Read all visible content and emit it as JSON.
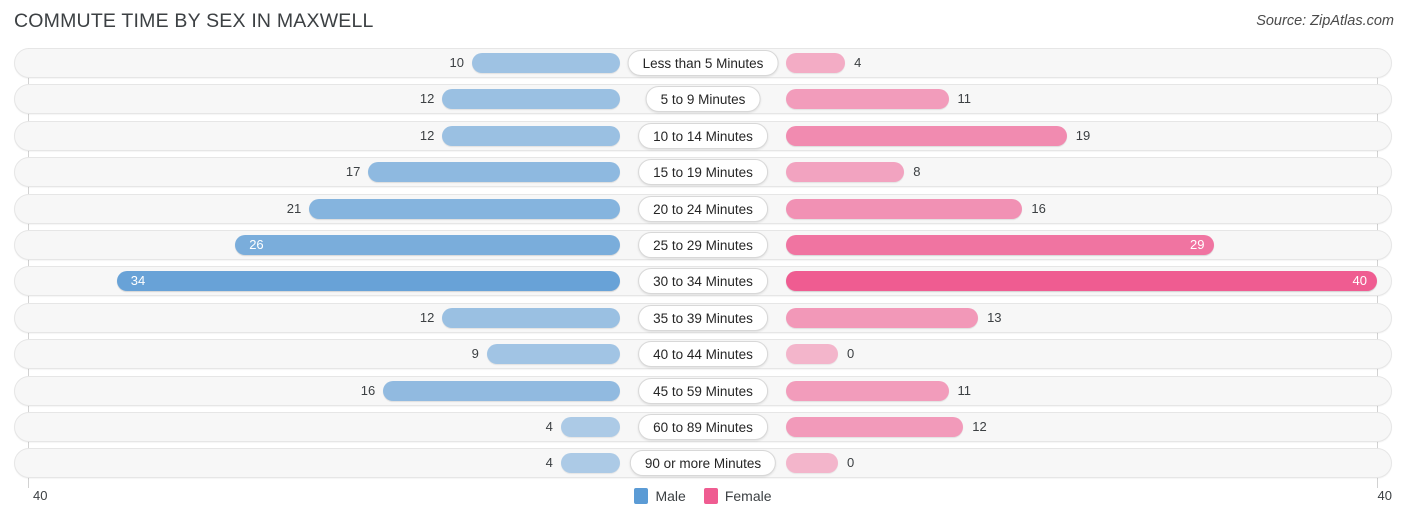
{
  "header": {
    "title": "COMMUTE TIME BY SEX IN MAXWELL",
    "source": "Source: ZipAtlas.com"
  },
  "legend": {
    "male_label": "Male",
    "female_label": "Female",
    "male_color": "#5B9BD5",
    "female_color": "#EF5C91"
  },
  "axis": {
    "left_tick": "40",
    "right_tick": "40",
    "max": 40
  },
  "chart_data": {
    "type": "bar",
    "title": "COMMUTE TIME BY SEX IN MAXWELL",
    "subtitle": "Source: ZipAtlas.com",
    "orientation": "horizontal-diverging",
    "xlabel": "",
    "ylabel": "",
    "xlim": [
      40,
      40
    ],
    "grid": false,
    "legend_position": "bottom-center",
    "categories": [
      "Less than 5 Minutes",
      "5 to 9 Minutes",
      "10 to 14 Minutes",
      "15 to 19 Minutes",
      "20 to 24 Minutes",
      "25 to 29 Minutes",
      "30 to 34 Minutes",
      "35 to 39 Minutes",
      "40 to 44 Minutes",
      "45 to 59 Minutes",
      "60 to 89 Minutes",
      "90 or more Minutes"
    ],
    "series": [
      {
        "name": "Male",
        "color": "#5B9BD5",
        "values": [
          10,
          12,
          12,
          17,
          21,
          26,
          34,
          12,
          9,
          16,
          4,
          4
        ]
      },
      {
        "name": "Female",
        "color": "#EF5C91",
        "values": [
          4,
          11,
          19,
          8,
          16,
          29,
          40,
          13,
          0,
          11,
          12,
          0
        ]
      }
    ]
  },
  "rows": [
    {
      "label": "Less than 5 Minutes",
      "male": 10,
      "female": 4,
      "male_text": "10",
      "female_text": "4"
    },
    {
      "label": "5 to 9 Minutes",
      "male": 12,
      "female": 11,
      "male_text": "12",
      "female_text": "11"
    },
    {
      "label": "10 to 14 Minutes",
      "male": 12,
      "female": 19,
      "male_text": "12",
      "female_text": "19"
    },
    {
      "label": "15 to 19 Minutes",
      "male": 17,
      "female": 8,
      "male_text": "17",
      "female_text": "8"
    },
    {
      "label": "20 to 24 Minutes",
      "male": 21,
      "female": 16,
      "male_text": "21",
      "female_text": "16"
    },
    {
      "label": "25 to 29 Minutes",
      "male": 26,
      "female": 29,
      "male_text": "26",
      "female_text": "29"
    },
    {
      "label": "30 to 34 Minutes",
      "male": 34,
      "female": 40,
      "male_text": "34",
      "female_text": "40"
    },
    {
      "label": "35 to 39 Minutes",
      "male": 12,
      "female": 13,
      "male_text": "12",
      "female_text": "13"
    },
    {
      "label": "40 to 44 Minutes",
      "male": 9,
      "female": 0,
      "male_text": "9",
      "female_text": "0"
    },
    {
      "label": "45 to 59 Minutes",
      "male": 16,
      "female": 11,
      "male_text": "16",
      "female_text": "11"
    },
    {
      "label": "60 to 89 Minutes",
      "male": 4,
      "female": 12,
      "male_text": "4",
      "female_text": "12"
    },
    {
      "label": "90 or more Minutes",
      "male": 4,
      "female": 0,
      "male_text": "4",
      "female_text": "0"
    }
  ]
}
